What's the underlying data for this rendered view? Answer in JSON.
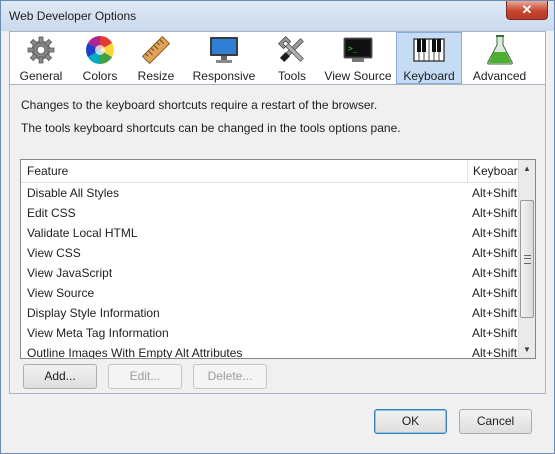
{
  "window": {
    "title": "Web Developer Options",
    "close_glyph": "✕"
  },
  "tabs": [
    {
      "label": "General",
      "icon": "gear-icon",
      "active": false
    },
    {
      "label": "Colors",
      "icon": "color-wheel-icon",
      "active": false
    },
    {
      "label": "Resize",
      "icon": "ruler-icon",
      "active": false
    },
    {
      "label": "Responsive",
      "icon": "monitor-icon",
      "active": false
    },
    {
      "label": "Tools",
      "icon": "tools-icon",
      "active": false
    },
    {
      "label": "View Source",
      "icon": "terminal-icon",
      "active": false
    },
    {
      "label": "Keyboard",
      "icon": "piano-keys-icon",
      "active": true
    },
    {
      "label": "Advanced",
      "icon": "flask-icon",
      "active": false
    }
  ],
  "messages": {
    "restart": "Changes to the keyboard shortcuts require a restart of the browser.",
    "tools": "The tools keyboard shortcuts can be changed in the tools options pane."
  },
  "table": {
    "headers": {
      "feature": "Feature",
      "keyboard": "Keyboard"
    },
    "rows": [
      {
        "feature": "Disable All Styles",
        "keyboard": "Alt+Shift"
      },
      {
        "feature": "Edit CSS",
        "keyboard": "Alt+Shift"
      },
      {
        "feature": "Validate Local HTML",
        "keyboard": "Alt+Shift"
      },
      {
        "feature": "View CSS",
        "keyboard": "Alt+Shift"
      },
      {
        "feature": "View JavaScript",
        "keyboard": "Alt+Shift"
      },
      {
        "feature": "View Source",
        "keyboard": "Alt+Shift"
      },
      {
        "feature": "Display Style Information",
        "keyboard": "Alt+Shift"
      },
      {
        "feature": "View Meta Tag Information",
        "keyboard": "Alt+Shift"
      },
      {
        "feature": "Outline Images With Empty Alt Attributes",
        "keyboard": "Alt+Shift"
      }
    ]
  },
  "buttons": {
    "add": "Add...",
    "edit": "Edit...",
    "delete": "Delete...",
    "ok": "OK",
    "cancel": "Cancel"
  }
}
